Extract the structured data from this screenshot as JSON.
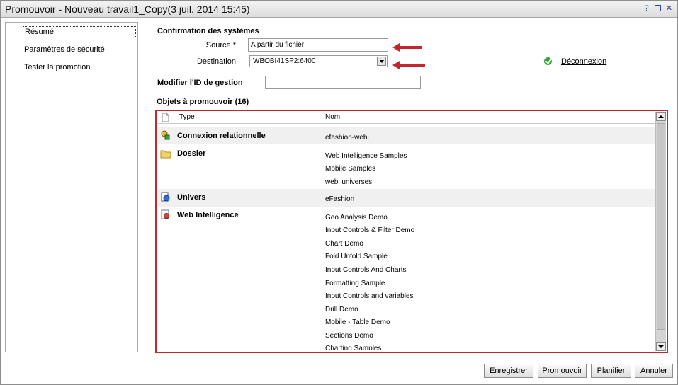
{
  "window": {
    "title": "Promouvoir - Nouveau travail1_Copy(3 juil. 2014 15:45)",
    "help_icon": "?",
    "colors": {
      "annotation_red": "#c1272d",
      "status_green": "#3aa33a"
    }
  },
  "nav": {
    "items": [
      {
        "label": "Résumé",
        "selected": true
      },
      {
        "label": "Paramètres de sécurité",
        "selected": false
      },
      {
        "label": "Tester la promotion",
        "selected": false
      }
    ]
  },
  "confirmation": {
    "title": "Confirmation des systèmes",
    "source_label": "Source *",
    "source_value": "A partir du fichier",
    "destination_label": "Destination",
    "destination_value": "WBOBI41SP2:6400",
    "status_icon": "check-circle-icon",
    "logout_link": "Déconnexion"
  },
  "management_id": {
    "label": "Modifier l'ID de gestion",
    "value": ""
  },
  "objects": {
    "title": "Objets à promouvoir (16)",
    "columns": {
      "type": "Type",
      "name": "Nom"
    },
    "rows": [
      {
        "icon": "relational-connection-icon",
        "type": "Connexion relationnelle",
        "names": [
          "efashion-webi"
        ]
      },
      {
        "icon": "folder-icon",
        "type": "Dossier",
        "names": [
          "Web Intelligence Samples",
          "Mobile Samples",
          "webi universes"
        ]
      },
      {
        "icon": "universe-icon",
        "type": "Univers",
        "names": [
          "eFashion"
        ]
      },
      {
        "icon": "web-intelligence-document-icon",
        "type": "Web Intelligence",
        "names": [
          "Geo Analysis Demo",
          "Input Controls & Filter Demo",
          "Chart Demo",
          "Fold Unfold Sample",
          "Input Controls And Charts",
          "Formatting Sample",
          "Input Controls and variables",
          "Drill Demo",
          "Mobile - Table Demo",
          "Sections Demo",
          "Charting Samples"
        ]
      }
    ]
  },
  "footer": {
    "save": "Enregistrer",
    "promote": "Promouvoir",
    "schedule": "Planifier",
    "cancel": "Annuler"
  }
}
